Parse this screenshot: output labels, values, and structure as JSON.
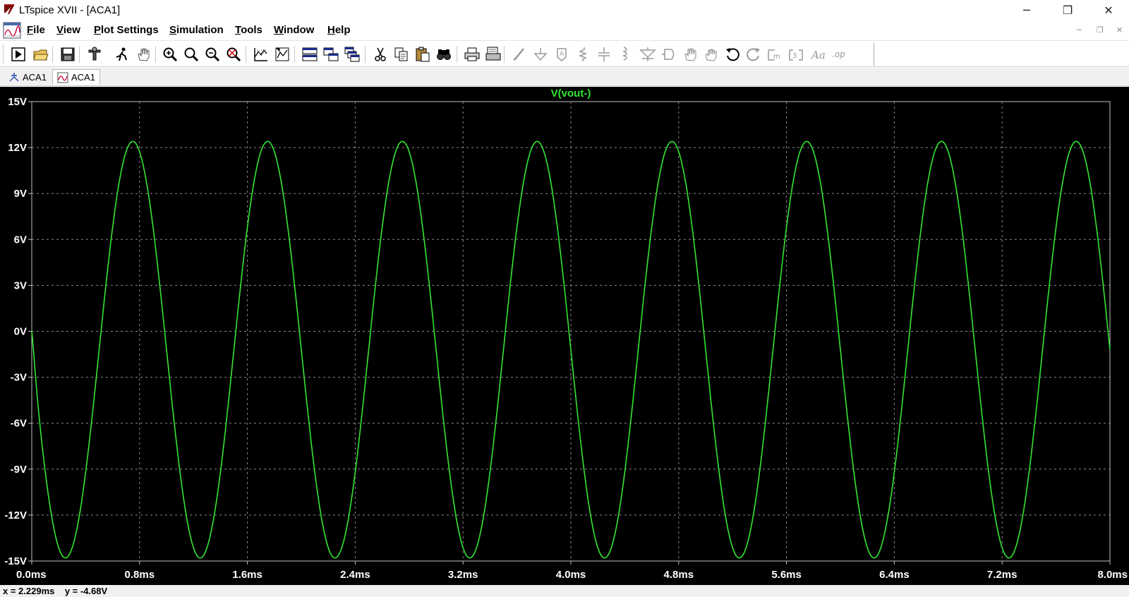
{
  "window": {
    "title": "LTspice XVII - [ACA1]",
    "minimize_glyph": "─",
    "maximize_glyph": "❐",
    "close_glyph": "✕"
  },
  "menubar": {
    "items": [
      {
        "label": "File",
        "hotkey": "F",
        "rest": "ile"
      },
      {
        "label": "View",
        "hotkey": "V",
        "rest": "iew"
      },
      {
        "label": "Plot Settings",
        "hotkey": "P",
        "rest": "lot Settings"
      },
      {
        "label": "Simulation",
        "hotkey": "S",
        "rest": "imulation"
      },
      {
        "label": "Tools",
        "hotkey": "T",
        "rest": "ools"
      },
      {
        "label": "Window",
        "hotkey": "W",
        "rest": "indow"
      },
      {
        "label": "Help",
        "hotkey": "H",
        "rest": "elp"
      }
    ],
    "mdi_glyphs": [
      "─",
      "❐",
      "✕"
    ]
  },
  "toolbar": {
    "icons": [
      "run-icon",
      "open-icon",
      "save-icon",
      "control-panel-icon",
      "halt-icon",
      "pan-icon",
      "zoom-area-icon",
      "zoom-in-icon",
      "zoom-out-icon",
      "zoom-fit-icon",
      "autorange-icon",
      "plot-settings-icon",
      "tile-horizontal-icon",
      "tile-vertical-icon",
      "cascade-icon",
      "cut-icon",
      "copy-icon",
      "paste-icon",
      "find-icon",
      "print-icon",
      "print-preview-icon",
      "wire-icon",
      "ground-icon",
      "label-net-icon",
      "resistor-icon",
      "capacitor-icon",
      "inductor-icon",
      "diode-icon",
      "component-icon",
      "move-icon",
      "drag-icon",
      "undo-icon",
      "redo-icon",
      "rotate-icon",
      "mirror-icon",
      "text-icon",
      "spice-directive-icon"
    ]
  },
  "tabs": [
    {
      "label": "ACA1",
      "icon": "schematic-icon",
      "active": false
    },
    {
      "label": "ACA1",
      "icon": "waveform-icon",
      "active": true
    }
  ],
  "colors": {
    "trace": "#33e633",
    "axis_text": "#ffffff",
    "grid": "#8a8a8a",
    "background": "#000000",
    "frame": "#c0c0c0"
  },
  "chart_data": {
    "type": "line",
    "title": "V(vout-)",
    "xlabel": "",
    "ylabel": "",
    "x_ticks": [
      "0.0ms",
      "0.8ms",
      "1.6ms",
      "2.4ms",
      "3.2ms",
      "4.0ms",
      "4.8ms",
      "5.6ms",
      "6.4ms",
      "7.2ms",
      "8.0ms"
    ],
    "y_ticks": [
      "15V",
      "12V",
      "9V",
      "6V",
      "3V",
      "0V",
      "-3V",
      "-6V",
      "-9V",
      "-12V",
      "-15V"
    ],
    "xlim": [
      0,
      8.0
    ],
    "ylim": [
      -15,
      15
    ],
    "x_unit": "ms",
    "y_unit": "V",
    "grid": true,
    "series": [
      {
        "name": "V(vout-)",
        "waveform": "sine",
        "frequency_khz": 1.0,
        "amplitude_v": 13.6,
        "offset_v": -1.2,
        "phase": "inverted",
        "x": [
          0.0,
          0.25,
          0.5,
          0.75,
          1.0,
          1.25,
          1.5,
          1.75,
          2.0,
          2.25,
          2.5,
          2.75,
          3.0,
          3.25,
          3.5,
          3.75,
          4.0,
          4.25,
          4.5,
          4.75,
          5.0,
          5.25,
          5.5,
          5.75,
          6.0,
          6.25,
          6.5,
          6.75,
          7.0,
          7.25,
          7.5,
          7.75,
          8.0
        ],
        "y": [
          0.0,
          -14.6,
          0.0,
          12.4,
          0.0,
          -14.6,
          0.0,
          12.4,
          0.0,
          -14.6,
          0.0,
          12.4,
          0.0,
          -14.6,
          0.0,
          12.4,
          0.0,
          -14.6,
          0.0,
          12.4,
          0.0,
          -14.6,
          0.0,
          12.4,
          0.0,
          -14.6,
          0.0,
          12.4,
          0.0,
          -14.6,
          0.0,
          12.4,
          0.0
        ]
      }
    ]
  },
  "status": {
    "text": "x = 2.229ms    y = -4.68V"
  }
}
